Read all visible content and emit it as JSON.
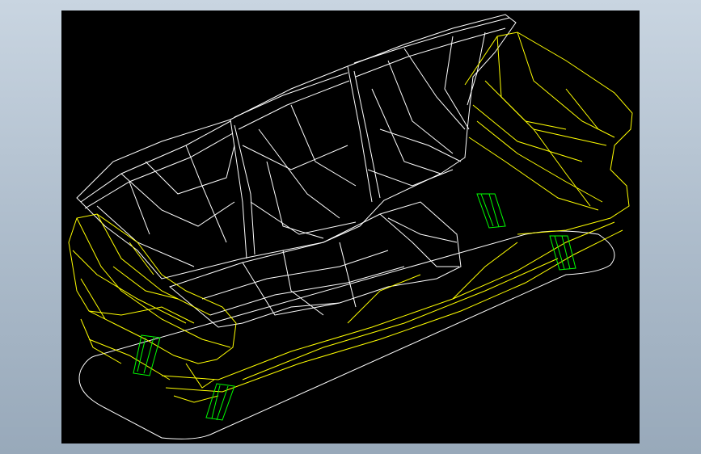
{
  "colors": {
    "background": "#b3c2d1",
    "viewport": "#000000",
    "body_wire": "#ffffff",
    "frame_wire": "#ffff00",
    "leg_wire": "#00ff00",
    "footprint_wire": "#ffffff"
  }
}
